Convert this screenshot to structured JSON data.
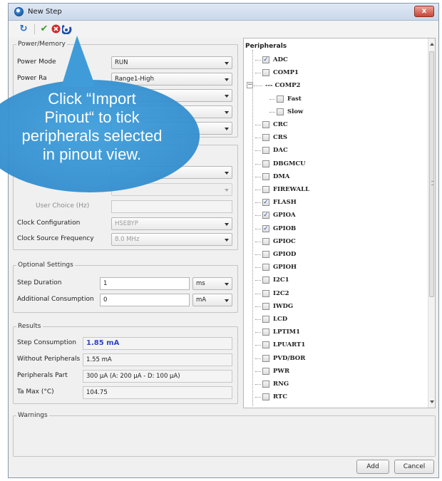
{
  "window": {
    "title": "New Step",
    "close_label": "x"
  },
  "toolbar": {
    "icons": [
      "refresh-icon",
      "check-icon",
      "cancel-icon",
      "import-pinout-icon"
    ]
  },
  "power_memory": {
    "legend": "Power/Memory",
    "rows": [
      {
        "label": "Power Mode",
        "value": "RUN"
      },
      {
        "label": "Power Ra",
        "value": "Range1-High"
      }
    ]
  },
  "clocks": {
    "user_choice_label": "User Choice (Hz)",
    "clock_config_label": "Clock Configuration",
    "clock_config_value": "HSEBYP",
    "clock_source_label": "Clock Source Frequency",
    "clock_source_value": "8.0 MHz"
  },
  "optional": {
    "legend": "Optional Settings",
    "step_duration_label": "Step Duration",
    "step_duration_value": "1",
    "step_duration_unit": "ms",
    "additional_consumption_label": "Additional Consumption",
    "additional_consumption_value": "0",
    "additional_consumption_unit": "mA"
  },
  "results": {
    "legend": "Results",
    "step_consumption_label": "Step Consumption",
    "step_consumption_value": "1.85 mA",
    "without_peripherals_label": "Without Peripherals",
    "without_peripherals_value": "1.55 mA",
    "peripherals_part_label": "Peripherals Part",
    "peripherals_part_value": "300 µA  (A: 200 µA - D: 100 µA)",
    "ta_max_label": "Ta Max (°C)",
    "ta_max_value": "104.75"
  },
  "peripherals": {
    "title": "Peripherals",
    "items": [
      {
        "label": "ADC",
        "checked": true,
        "level": 0
      },
      {
        "label": "COMP1",
        "checked": false,
        "level": 0
      },
      {
        "label": "COMP2",
        "checked": false,
        "level": 0,
        "group": true
      },
      {
        "label": "Fast",
        "checked": false,
        "level": 1
      },
      {
        "label": "Slow",
        "checked": false,
        "level": 1
      },
      {
        "label": "CRC",
        "checked": false,
        "level": 0
      },
      {
        "label": "CRS",
        "checked": false,
        "level": 0
      },
      {
        "label": "DAC",
        "checked": false,
        "level": 0
      },
      {
        "label": "DBGMCU",
        "checked": false,
        "level": 0
      },
      {
        "label": "DMA",
        "checked": false,
        "level": 0
      },
      {
        "label": "FIREWALL",
        "checked": false,
        "level": 0
      },
      {
        "label": "FLASH",
        "checked": true,
        "level": 0
      },
      {
        "label": "GPIOA",
        "checked": true,
        "level": 0
      },
      {
        "label": "GPIOB",
        "checked": true,
        "level": 0
      },
      {
        "label": "GPIOC",
        "checked": false,
        "level": 0
      },
      {
        "label": "GPIOD",
        "checked": false,
        "level": 0
      },
      {
        "label": "GPIOH",
        "checked": false,
        "level": 0
      },
      {
        "label": "I2C1",
        "checked": false,
        "level": 0
      },
      {
        "label": "I2C2",
        "checked": false,
        "level": 0
      },
      {
        "label": "IWDG",
        "checked": false,
        "level": 0
      },
      {
        "label": "LCD",
        "checked": false,
        "level": 0
      },
      {
        "label": "LPTIM1",
        "checked": false,
        "level": 0
      },
      {
        "label": "LPUART1",
        "checked": false,
        "level": 0
      },
      {
        "label": "PVD/BOR",
        "checked": false,
        "level": 0
      },
      {
        "label": "PWR",
        "checked": false,
        "level": 0
      },
      {
        "label": "RNG",
        "checked": false,
        "level": 0
      },
      {
        "label": "RTC",
        "checked": false,
        "level": 0
      }
    ]
  },
  "warnings": {
    "legend": "Warnings"
  },
  "buttons": {
    "add": "Add",
    "cancel": "Cancel"
  },
  "callout": {
    "line1": "Click “Import",
    "line2": "Pinout“ to tick",
    "line3": "peripherals selected",
    "line4": "in pinout view."
  }
}
